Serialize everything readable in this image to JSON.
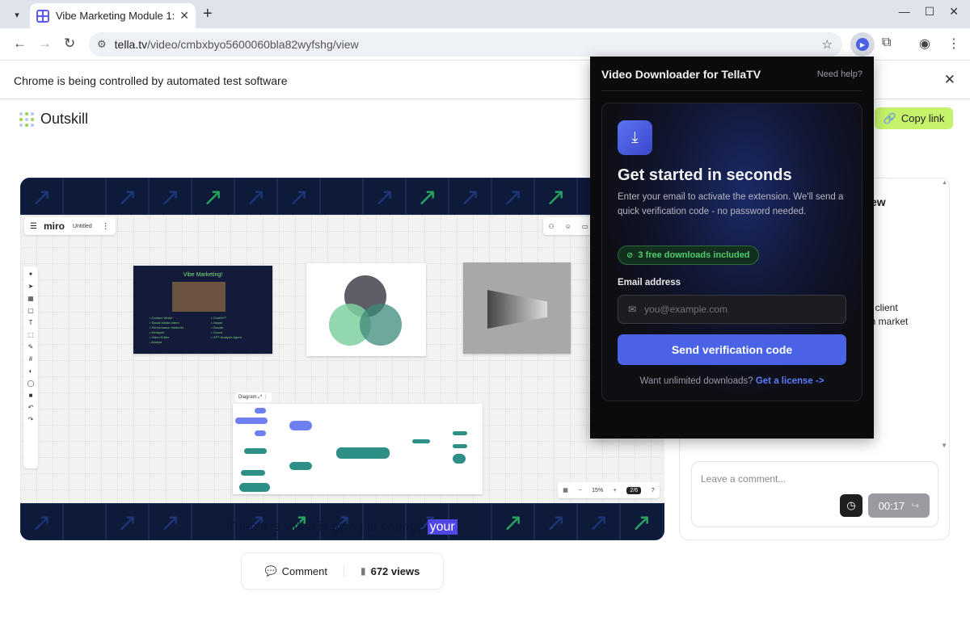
{
  "browser": {
    "tab_title": "Vibe Marketing Module 1:",
    "url_host": "tella.tv",
    "url_path": "/video/cmbxbyo5600060bla82wyfshg/view",
    "infobar_text": "Chrome is being controlled by automated test software"
  },
  "page": {
    "brand": "Outskill",
    "copy_link_label": "Copy link",
    "caption_text": "Then this video is going to change ",
    "caption_highlight": "your",
    "comment_label": "Comment",
    "views_label": "672 views"
  },
  "miro": {
    "logo": "miro",
    "board_name": "Untitled",
    "frame1_title": "Vibe Marketing!",
    "diagram_label": "Diagram",
    "zoom": "15%",
    "page_indicator": "2/6"
  },
  "side_panel": {
    "peek_heading": "ew",
    "peek_line1": "al client",
    "peek_line2": "an market",
    "comment_placeholder": "Leave a comment...",
    "timestamp": "00:17"
  },
  "extension": {
    "title": "Video Downloader for TellaTV",
    "help": "Need help?",
    "heading": "Get started in seconds",
    "description": "Enter your email to activate the extension. We'll send a quick verification code - no password needed.",
    "badge": "3 free downloads included",
    "email_label": "Email address",
    "email_placeholder": "you@example.com",
    "send_button": "Send verification code",
    "license_text": "Want unlimited downloads? ",
    "license_link": "Get a license ->"
  },
  "colors": {
    "accent": "#4a63e6",
    "copy_link_bg": "#c6f26b",
    "badge_green": "#4ecb6c",
    "caption_highlight_bg": "#4f46e5"
  }
}
